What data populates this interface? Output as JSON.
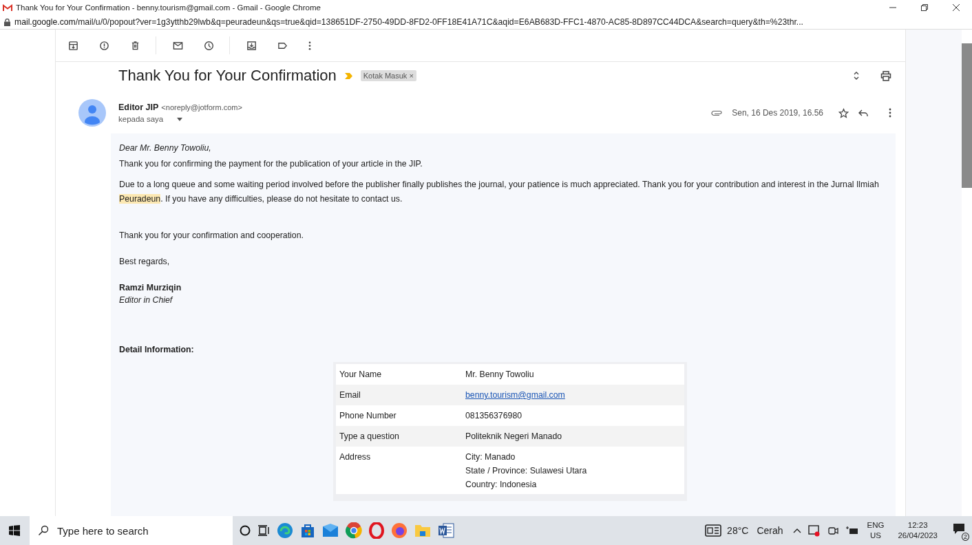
{
  "window": {
    "title": "Thank You for Your Confirmation - benny.tourism@gmail.com - Gmail - Google Chrome"
  },
  "address_bar": {
    "host": "mail.google.com",
    "path": "/mail/u/0/popout?ver=1g3ytthb29lwb&q=peuradeun&qs=true&qid=138651DF-2750-49DD-8FD2-0FF18E41A71C&aqid=E6AB683D-FFC1-4870-AC85-8D897CC44DCA&search=query&th=%23thr..."
  },
  "message": {
    "subject": "Thank You for Your Confirmation",
    "label": {
      "text": "Kotak Masuk",
      "close": "×"
    },
    "sender": {
      "name": "Editor JIP",
      "email": "<noreply@jotform.com>",
      "recipient": "kepada saya"
    },
    "date": "Sen, 16 Des 2019, 16.56",
    "starred": false
  },
  "body": {
    "greeting": "Dear Mr. Benny Towoliu,",
    "paragraphs": [
      {
        "parts": [
          {
            "text": "Thank you for confirming the payment for the publication of your article in the JIP.",
            "highlight": false
          }
        ]
      },
      {
        "parts": [
          {
            "text": "Due to a long queue and some waiting period involved before the publisher finally publishes the journal, your patience is much appreciated.  Thank you for your contribution and interest in the Jurnal Ilmiah ",
            "highlight": false
          },
          {
            "text": "Peuradeun",
            "highlight": true
          },
          {
            "text": ". If you have any difficulties, please do not hesitate to contact us.",
            "highlight": false
          }
        ]
      },
      {
        "parts": [
          {
            "text": "Thank you for your confirmation and cooperation.",
            "highlight": false
          }
        ]
      },
      {
        "parts": [
          {
            "text": "Best regards,",
            "highlight": false
          }
        ]
      }
    ],
    "signature": {
      "name": "Ramzi Murziqin",
      "role": "Editor in Chief"
    },
    "detail_heading": "Detail Information:",
    "table": [
      {
        "label": "Your Name",
        "value": [
          "Mr. Benny Towoliu"
        ],
        "kind": "text"
      },
      {
        "label": "Email",
        "value": [
          "benny.tourism@gmail.com"
        ],
        "kind": "link"
      },
      {
        "label": "Phone Number",
        "value": [
          "081356376980"
        ],
        "kind": "text"
      },
      {
        "label": "Type a question",
        "value": [
          "Politeknik Negeri Manado"
        ],
        "kind": "text"
      },
      {
        "label": "Address",
        "value": [
          "City: Manado",
          "State / Province: Sulawesi Utara",
          "Country: Indonesia"
        ],
        "kind": "text"
      }
    ]
  },
  "taskbar": {
    "search_placeholder": "Type here to search",
    "weather": {
      "temp": "28°C",
      "condition": "Cerah"
    },
    "language": {
      "code": "ENG",
      "region": "US"
    },
    "clock": {
      "time": "12:23",
      "date": "26/04/2023"
    },
    "notifications": "2"
  }
}
